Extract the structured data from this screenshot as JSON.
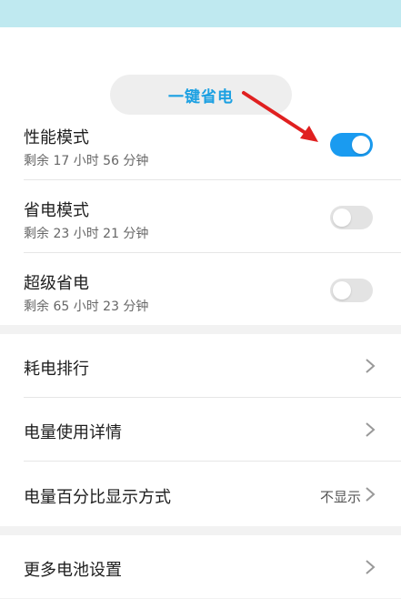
{
  "top_button": {
    "label": "一键省电"
  },
  "modes": [
    {
      "title": "性能模式",
      "remaining": "剩余 17 小时 56 分钟",
      "enabled": true
    },
    {
      "title": "省电模式",
      "remaining": "剩余 23 小时 21 分钟",
      "enabled": false
    },
    {
      "title": "超级省电",
      "remaining": "剩余 65 小时 23 分钟",
      "enabled": false
    }
  ],
  "settings": [
    {
      "label": "耗电排行",
      "value": ""
    },
    {
      "label": "电量使用详情",
      "value": ""
    },
    {
      "label": "电量百分比显示方式",
      "value": "不显示"
    }
  ],
  "more": {
    "label": "更多电池设置"
  },
  "colors": {
    "accent": "#1a9bf0",
    "button_text": "#1ba0e2",
    "annotation_arrow": "#e02020",
    "banner": "#bfe9f0"
  },
  "icons": {
    "annotation": "red-arrow-icon",
    "chevron": "chevron-right-icon"
  }
}
